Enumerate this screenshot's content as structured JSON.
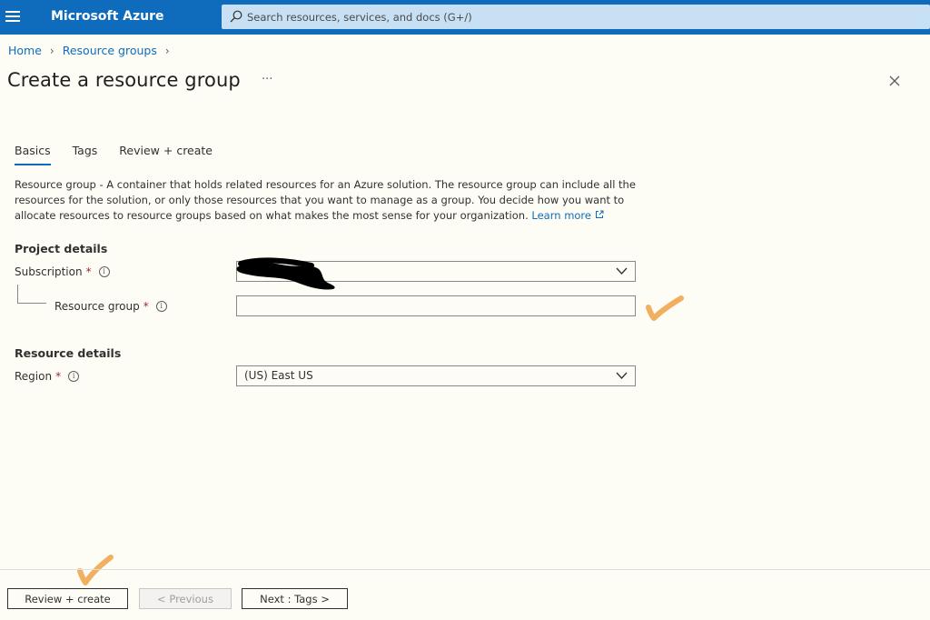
{
  "header": {
    "brand": "Microsoft Azure",
    "search_placeholder": "Search resources, services, and docs (G+/)"
  },
  "breadcrumb": {
    "items": [
      "Home",
      "Resource groups"
    ]
  },
  "page": {
    "title": "Create a resource group",
    "more": "···"
  },
  "tabs": [
    {
      "label": "Basics",
      "active": true
    },
    {
      "label": "Tags",
      "active": false
    },
    {
      "label": "Review + create",
      "active": false
    }
  ],
  "description": {
    "term": "Resource group",
    "text": " - A container that holds related resources for an Azure solution. The resource group can include all the resources for the solution, or only those resources that you want to manage as a group. You decide how you want to allocate resources to resource groups based on what makes the most sense for your organization.",
    "link": "Learn more"
  },
  "project_details": {
    "heading": "Project details",
    "subscription_label": "Subscription",
    "subscription_value": "",
    "resource_group_label": "Resource group",
    "resource_group_value": ""
  },
  "resource_details": {
    "heading": "Resource details",
    "region_label": "Region",
    "region_value": "(US) East US"
  },
  "footer": {
    "review_create": "Review + create",
    "previous": "< Previous",
    "next": "Next : Tags >"
  },
  "colors": {
    "topbar": "#0f6cbd",
    "link": "#0f6cbd",
    "required": "#a4262c",
    "annotation_check": "#f0b060"
  }
}
